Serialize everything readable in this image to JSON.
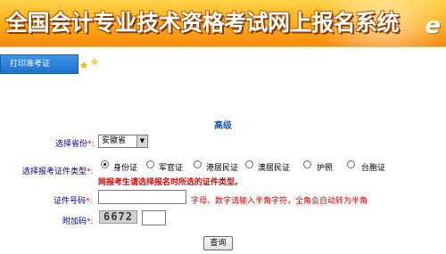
{
  "header": {
    "title": "全国会计专业技术资格考试网上报名系统",
    "logo_glyph": "e"
  },
  "nav": {
    "tab_label": "打印准考证",
    "icons": [
      "star-icon",
      "star-icon"
    ]
  },
  "form": {
    "section_title": "高级",
    "province": {
      "label": "选择省份",
      "required_mark": "*:",
      "selected": "安徽省"
    },
    "id_type": {
      "label": "选择报考证件类型",
      "required_mark": "*:",
      "options": [
        "身份证",
        "军官证",
        "港居民证",
        "澳居民证",
        "护照",
        "台胞证"
      ],
      "selected_index": 0,
      "warning": "网报考生请选择报名时所选的证件类型。"
    },
    "id_number": {
      "label": "证件号码",
      "required_mark": "*:",
      "value": "",
      "hint": "字母、数字请输入半角字符，全角会自动转为半角"
    },
    "captcha": {
      "label": "附加码",
      "required_mark": "*:",
      "code": "6672",
      "value": ""
    },
    "submit_label": "查询"
  },
  "colors": {
    "banner_top": "#ffd34a",
    "banner_bottom": "#f58a0d",
    "tab_blue": "#1f6fcf",
    "label_navy": "#000080",
    "section_title_blue": "#1b5aa8",
    "warning_red": "#e00000"
  }
}
